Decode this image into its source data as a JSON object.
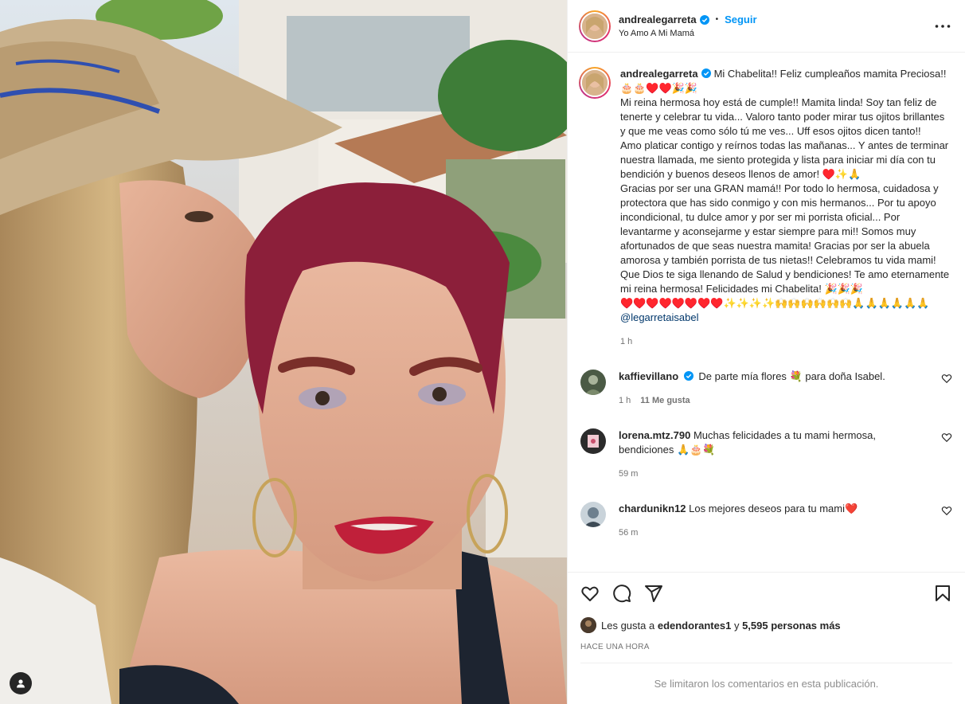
{
  "colors": {
    "link_blue": "#0095f6",
    "verified_blue": "#0095f6",
    "heart_red": "#ed4956",
    "muted_text": "#737373"
  },
  "photo": {
    "alt": "Selfie de Andrea Legarreta besando a su mamá"
  },
  "header": {
    "username": "andrealegarreta",
    "separator": "•",
    "follow_label": "Seguir",
    "subtitle": "Yo Amo A Mi Mamá",
    "more_icon": "more-horizontal-icon"
  },
  "caption": {
    "username": "andrealegarreta",
    "text": "Mi Chabelita!! Feliz cumpleaños mamita Preciosa!! 🎂🎂♥️♥️🎉🎉\nMi reina hermosa hoy está de cumple!! Mamita linda! Soy tan feliz de tenerte y celebrar tu vida... Valoro tanto poder mirar tus ojitos brillantes y que me veas como sólo tú me ves... Uff esos ojitos dicen tanto!!\nAmo platicar contigo y reírnos todas las mañanas... Y antes de terminar nuestra llamada, me siento protegida y lista para iniciar mi día con tu bendición y buenos deseos llenos de amor! ♥️✨🙏\nGracias por ser una GRAN mamá!! Por todo lo hermosa, cuidadosa y protectora que has sido conmigo y con mis hermanos... Por tu apoyo incondicional, tu dulce amor y por ser mi porrista oficial... Por levantarme y aconsejarme y estar siempre para mi!! Somos muy afortunados de que seas nuestra mamita! Gracias por ser la abuela amorosa y también porrista de tus nietas!! Celebramos tu vida mami! Que Dios te siga llenando de Salud y bendiciones! Te amo eternamente mi reina hermosa! Felicidades mi Chabelita! 🎉🎉🎉\n♥️♥️♥️♥️♥️♥️♥️♥️✨✨✨✨🙌🙌🙌🙌🙌🙌🙏🙏🙏🙏🙏🙏",
    "mention": "@legarretaisabel",
    "time": "1 h"
  },
  "comments": [
    {
      "username": "kaffievillano",
      "text": "De parte mía flores 💐 para doña Isabel.",
      "time": "1 h",
      "likes": "11 Me gusta",
      "verified": true,
      "avatar_color": "#4b5a45"
    },
    {
      "username": "lorena.mtz.790",
      "text": "Muchas felicidades a tu mami hermosa, bendiciones 🙏🎂💐",
      "time": "59 m",
      "likes": "",
      "verified": false,
      "avatar_color": "#2b2b2b"
    },
    {
      "username": "chardunikn12",
      "text": "Los mejores deseos para tu mami❤️",
      "time": "56 m",
      "likes": "",
      "verified": false,
      "avatar_color": "#6d7f8e"
    }
  ],
  "actions": {
    "like_icon": "heart-icon",
    "comment_icon": "comment-icon",
    "share_icon": "send-icon",
    "save_icon": "bookmark-icon"
  },
  "likes": {
    "prefix": "Les gusta a",
    "user": "edendorantes1",
    "connector": "y",
    "others": "5,595 personas más"
  },
  "post_time": "HACE UNA HORA",
  "comments_limited": "Se limitaron los comentarios en esta publicación."
}
